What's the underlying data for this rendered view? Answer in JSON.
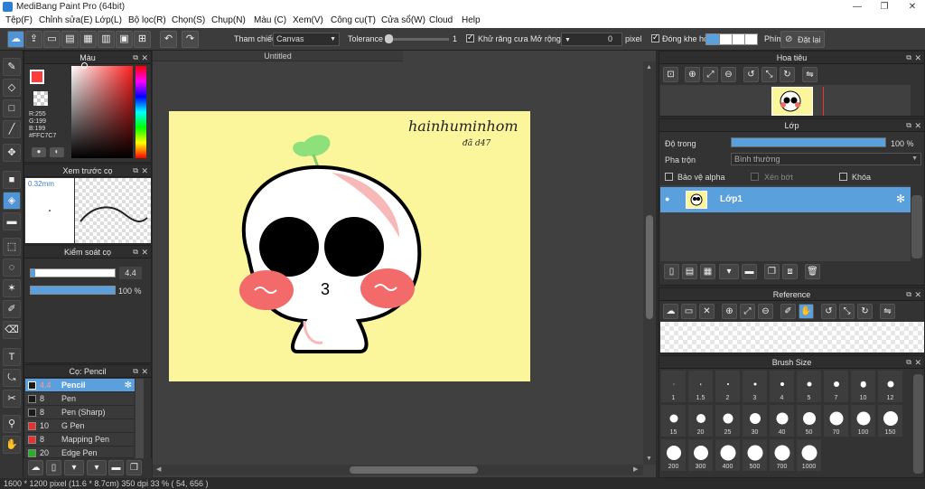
{
  "window": {
    "title": "MediBang Paint Pro (64bit)",
    "minimize": "—",
    "maximize": "❐",
    "close": "✕"
  },
  "menu": [
    "Tệp(F)",
    "Chỉnh sửa(E)",
    "Lớp(L)",
    "Bộ lọc(R)",
    "Chọn(S)",
    "Chụp(N)",
    "Màu (C)",
    "Xem(V)",
    "Công cụ(T)",
    "Cửa sổ(W)",
    "Cloud",
    "Help"
  ],
  "toolbar": {
    "ref_label": "Tham chiếu",
    "ref_value": "Canvas",
    "tolerance_label": "Tolerance",
    "tolerance_value": "1",
    "antialias_label": "Khử răng cưa",
    "expand_label": "Mở rộng",
    "expand_value": "0",
    "expand_unit": "pixel",
    "close_gap_label": "Đóng khe hở",
    "shortcut_label": "Phím",
    "reset_label": "Đặt lại"
  },
  "color_panel": {
    "title": "Màu",
    "r": "R:255",
    "g": "G:199",
    "b": "B:199",
    "hex": "#FFC7C7",
    "color": "#FFC7C7"
  },
  "preview_panel": {
    "title": "Xem trước cọ",
    "size": "0.32mm"
  },
  "control_panel": {
    "title": "Kiểm soát cọ",
    "size_value": "4.4",
    "opacity_value": "100 %"
  },
  "brush_panel": {
    "title": "Cọ: Pencil",
    "items": [
      {
        "size": "4.4",
        "name": "Pencil",
        "color": "#1a1a1a",
        "selected": true
      },
      {
        "size": "8",
        "name": "Pen",
        "color": "#1a1a1a"
      },
      {
        "size": "8",
        "name": "Pen (Sharp)",
        "color": "#1a1a1a"
      },
      {
        "size": "10",
        "name": "G Pen",
        "color": "#e83030"
      },
      {
        "size": "8",
        "name": "Mapping Pen",
        "color": "#e83030"
      },
      {
        "size": "20",
        "name": "Edge Pen",
        "color": "#28b028"
      }
    ]
  },
  "document": {
    "tab": "Untitled",
    "signature": "hainhuminhom",
    "signature_sub": "đã d47",
    "mouth": "3"
  },
  "status_bar": "1600 * 1200 pixel   (11.6 * 8.7cm)  350 dpi  33 %  ( 54, 656 )",
  "navigator": {
    "title": "Hoa tiêu"
  },
  "layer_panel": {
    "title": "Lớp",
    "opacity_label": "Độ trong",
    "opacity_value": "100 %",
    "opacity_fraction": 1.0,
    "blend_label": "Pha trộn",
    "blend_value": "Bình thường",
    "protect_alpha": "Bảo vệ alpha",
    "clipping": "Xén bớt",
    "lock": "Khóa",
    "layer_name": "Lớp1"
  },
  "reference_panel": {
    "title": "Reference"
  },
  "brush_size_panel": {
    "title": "Brush Size",
    "sizes": [
      "1",
      "1.5",
      "2",
      "3",
      "4",
      "5",
      "7",
      "10",
      "12",
      "15",
      "20",
      "25",
      "30",
      "40",
      "50",
      "70",
      "100",
      "150",
      "200",
      "300",
      "400",
      "500",
      "700",
      "1000"
    ]
  }
}
